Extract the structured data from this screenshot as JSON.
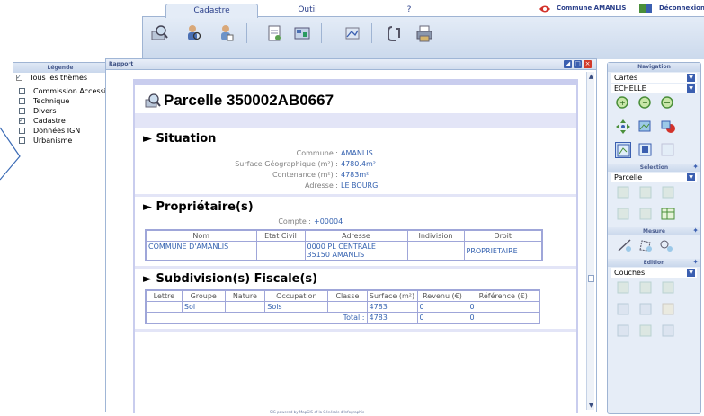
{
  "tabs": [
    {
      "label": "Cadastre",
      "active": true
    },
    {
      "label": "Outil",
      "active": false
    },
    {
      "label": "?",
      "active": false
    }
  ],
  "toolbar": {
    "icons": [
      "parcel-search-icon",
      "owner-search-icon",
      "person-search-icon",
      "document-icon",
      "export-icon",
      "map-icon",
      "clip-icon",
      "print-icon"
    ]
  },
  "user": {
    "commune_label": "Commune AMANLIS",
    "logout_label": "Déconnexion"
  },
  "legend": {
    "title": "Légende",
    "items": [
      {
        "label": "Tous les thèmes",
        "checked": true
      },
      {
        "label": "Commission Accessibilité",
        "checked": false
      },
      {
        "label": "Technique",
        "checked": false
      },
      {
        "label": "Divers",
        "checked": false
      },
      {
        "label": "Cadastre",
        "checked": true
      },
      {
        "label": "Données IGN",
        "checked": false
      },
      {
        "label": "Urbanisme",
        "checked": false
      }
    ]
  },
  "rapport": {
    "window_title": "Rapport",
    "parcel_title": "Parcelle 350002AB0667",
    "situation": {
      "title": "► Situation",
      "rows": [
        {
          "k": "Commune : ",
          "v": "AMANLIS"
        },
        {
          "k": "Surface Géographique (m²) : ",
          "v": "4780.4m²"
        },
        {
          "k": "Contenance (m²) : ",
          "v": "4783m²"
        },
        {
          "k": "Adresse : ",
          "v": "LE BOURG"
        }
      ]
    },
    "proprietaires": {
      "title": "► Propriétaire(s)",
      "compte_label": "Compte : ",
      "compte_value": "+00004",
      "headers": [
        "Nom",
        "Etat Civil",
        "Adresse",
        "Indivision",
        "Droit"
      ],
      "rows": [
        {
          "nom": "COMMUNE D'AMANLIS",
          "etat": "",
          "adresse1": "0000 PL CENTRALE",
          "adresse2": "35150 AMANLIS",
          "indivision": "",
          "droit": "PROPRIETAIRE"
        }
      ]
    },
    "subdivisions": {
      "title": "► Subdivision(s) Fiscale(s)",
      "headers": [
        "Lettre",
        "Groupe",
        "Nature",
        "Occupation",
        "Classe",
        "Surface (m²)",
        "Revenu (€)",
        "Référence (€)"
      ],
      "rows": [
        {
          "lettre": "",
          "groupe": "Sol",
          "nature": "",
          "occupation": "Sols",
          "classe": "",
          "surface": "4783",
          "revenu": "0",
          "reference": "0"
        }
      ],
      "total_label": "Total :",
      "total_surface": "4783",
      "total_revenu": "0",
      "total_reference": "0"
    },
    "footer": "SIG powered by MapGIS of la Générale d'Infographie"
  },
  "navigation": {
    "title": "Navigation",
    "map_select": "Cartes",
    "scale_select": "ECHELLE",
    "selection_title": "Sélection",
    "selection_select": "Parcelle",
    "mesure_title": "Mesure",
    "edition_title": "Edition",
    "edition_select": "Couches"
  }
}
